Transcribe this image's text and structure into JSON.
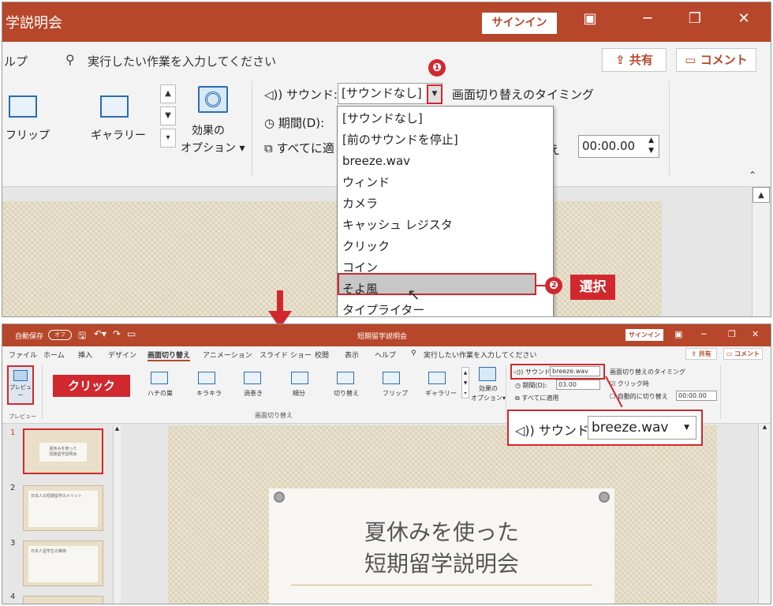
{
  "top": {
    "doc_title": "学説明会",
    "signin": "サインイン",
    "window_controls": [
      "▣",
      "─",
      "❐",
      "✕"
    ],
    "help": "ルプ",
    "tell_me": "実行したい作業を入力してください",
    "share": "共有",
    "comment": "コメント",
    "effects": [
      {
        "label": "フリップ"
      },
      {
        "label": "ギャラリー"
      }
    ],
    "effect_options_1": "効果の",
    "effect_options_2": "オプション ▾",
    "sound_label": "サウンド:",
    "sound_value": "[サウンドなし]",
    "timing_label": "画面切り替えのタイミング",
    "duration_label": "期間(D):",
    "apply_all": "すべてに適",
    "advance_suffix": "え",
    "advance_time": "00:00.00",
    "dropdown_items": [
      "[サウンドなし]",
      "[前のサウンドを停止]",
      "breeze.wav",
      "ウィンド",
      "カメラ",
      "キャッシュ レジスタ",
      "クリック",
      "コイン",
      "そよ風",
      "タイプライター"
    ],
    "callout_1": "❶",
    "callout_2": "❷",
    "callout_2_label": "選択"
  },
  "bottom": {
    "autosave": "自動保存",
    "autosave_state": "オフ",
    "doc_title": "短期留学説明会",
    "signin": "サインイン",
    "tabs": [
      "ファイル",
      "ホーム",
      "挿入",
      "デザイン",
      "画面切り替え",
      "アニメーション",
      "スライド ショー",
      "校閲",
      "表示",
      "ヘルプ"
    ],
    "tell_me": "実行したい作業を入力してください",
    "share": "共有",
    "comment": "コメント",
    "preview_label": "プレビュー",
    "preview_group": "プレビュー",
    "effects": [
      "ハチの巣",
      "キラキラ",
      "渦巻き",
      "細分",
      "切り替え",
      "フリップ",
      "ギャラリー"
    ],
    "effect_options_1": "効果の",
    "effect_options_2": "オプション▾",
    "group_label": "画面切り替え",
    "sound_label": "サウンド:",
    "sound_value": "breeze.wav",
    "duration_label": "期間(D):",
    "duration_value": "03.00",
    "apply_all": "すべてに適用",
    "timing_label": "画面切り替えのタイミング",
    "on_click": "クリック時",
    "auto_advance": "自動的に切り替え",
    "auto_time": "00:00.00",
    "zoom_sound_label": "サウンド:",
    "zoom_sound_value": "breeze.wav",
    "callout_click": "クリック",
    "slide_numbers": [
      "1",
      "2",
      "3",
      "4"
    ],
    "thumb_1_l1": "夏休みを使った",
    "thumb_1_l2": "短期留学説明会",
    "thumb_2_title": "日本人の短期留学のメリット",
    "thumb_3_title": "日本人留学生の推移",
    "slide_title_1": "夏休みを使った",
    "slide_title_2": "短期留学説明会"
  }
}
